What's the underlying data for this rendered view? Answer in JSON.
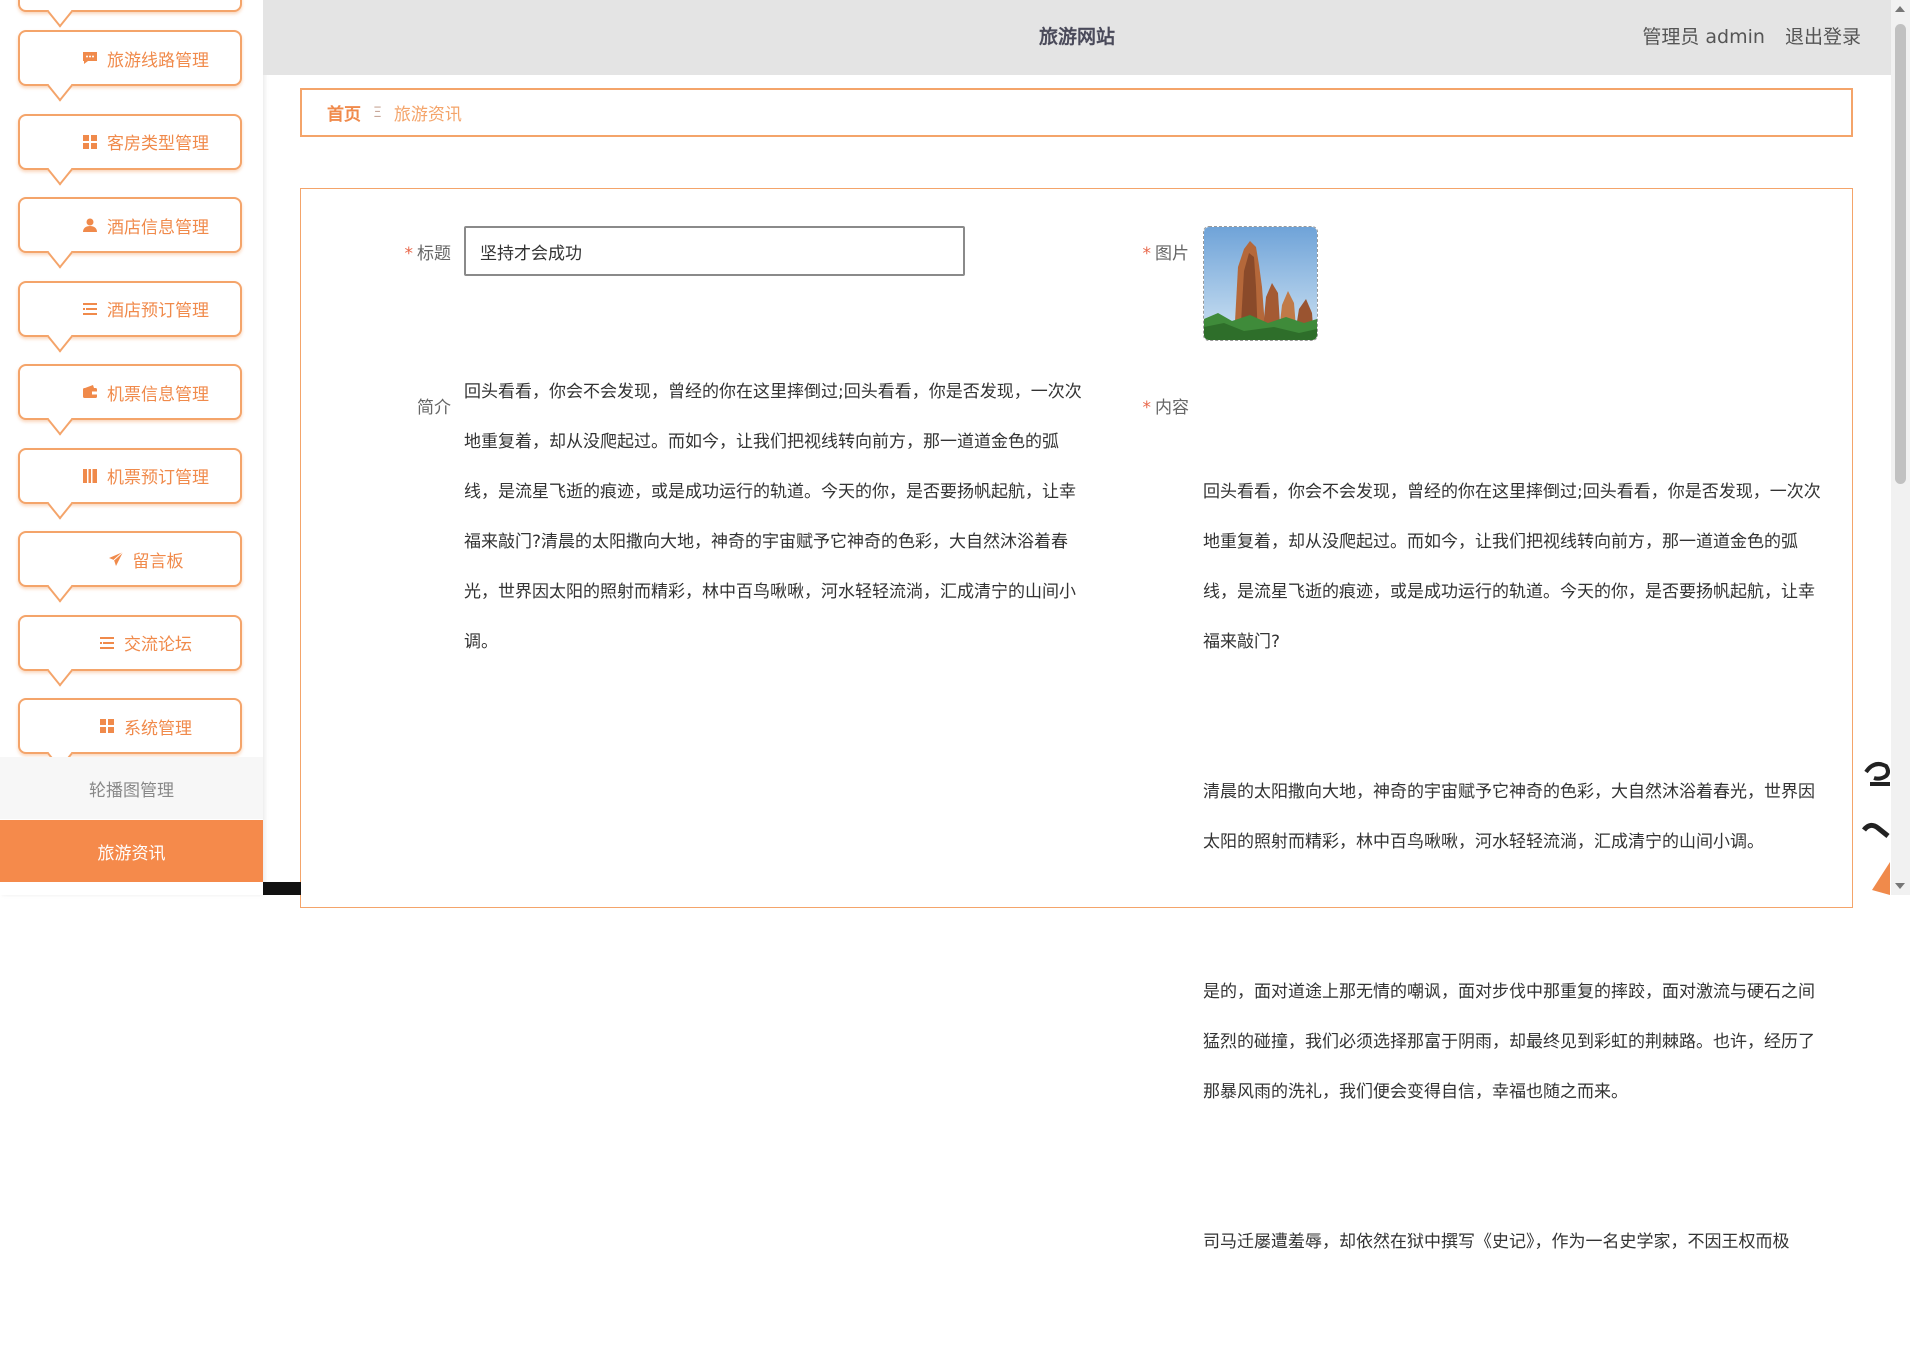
{
  "header": {
    "site_title": "旅游网站",
    "user_label": "管理员 admin",
    "logout_label": "退出登录"
  },
  "sidebar": {
    "menu_items": [
      {
        "label": "旅游线路管理",
        "icon": "chat-icon"
      },
      {
        "label": "客房类型管理",
        "icon": "grid-icon"
      },
      {
        "label": "酒店信息管理",
        "icon": "user-icon"
      },
      {
        "label": "酒店预订管理",
        "icon": "list-icon"
      },
      {
        "label": "机票信息管理",
        "icon": "wallet-icon"
      },
      {
        "label": "机票预订管理",
        "icon": "book-icon"
      },
      {
        "label": "留言板",
        "icon": "send-icon"
      },
      {
        "label": "交流论坛",
        "icon": "list-icon"
      },
      {
        "label": "系统管理",
        "icon": "grid-icon"
      }
    ],
    "sub_items": [
      {
        "label": "轮播图管理",
        "active": false
      },
      {
        "label": "旅游资讯",
        "active": true
      }
    ]
  },
  "breadcrumb": {
    "home": "首页",
    "separator": "Ξ",
    "current": "旅游资讯"
  },
  "form": {
    "title_label": "标题",
    "title_value": "坚持才会成功",
    "image_label": "图片",
    "summary_label": "简介",
    "summary_text": "回头看看，你会不会发现，曾经的你在这里摔倒过;回头看看，你是否发现，一次次地重复着，却从没爬起过。而如今，让我们把视线转向前方，那一道道金色的弧线，是流星飞逝的痕迹，或是成功运行的轨道。今天的你，是否要扬帆起航，让幸福来敲门?清晨的太阳撒向大地，神奇的宇宙赋予它神奇的色彩，大自然沐浴着春光，世界因太阳的照射而精彩，林中百鸟啾啾，河水轻轻流淌，汇成清宁的山间小调。",
    "content_label": "内容",
    "content_paragraphs": [
      "回头看看，你会不会发现，曾经的你在这里摔倒过;回头看看，你是否发现，一次次地重复着，却从没爬起过。而如今，让我们把视线转向前方，那一道道金色的弧线，是流星飞逝的痕迹，或是成功运行的轨道。今天的你，是否要扬帆起航，让幸福来敲门?",
      "清晨的太阳撒向大地，神奇的宇宙赋予它神奇的色彩，大自然沐浴着春光，世界因太阳的照射而精彩，林中百鸟啾啾，河水轻轻流淌，汇成清宁的山间小调。",
      "是的，面对道途上那无情的嘲讽，面对步伐中那重复的摔跤，面对激流与硬石之间猛烈的碰撞，我们必须选择那富于阴雨，却最终见到彩虹的荆棘路。也许，经历了那暴风雨的洗礼，我们便会变得自信，幸福也随之而来。",
      "司马迁屡遭羞辱，却依然在狱中撰写《史记》，作为一名史学家，不因王权而极"
    ]
  },
  "colors": {
    "accent": "#f08a4b",
    "accent_light": "#f4a46a",
    "header_bg": "#e4e4e4",
    "required_star": "#e8674a"
  }
}
